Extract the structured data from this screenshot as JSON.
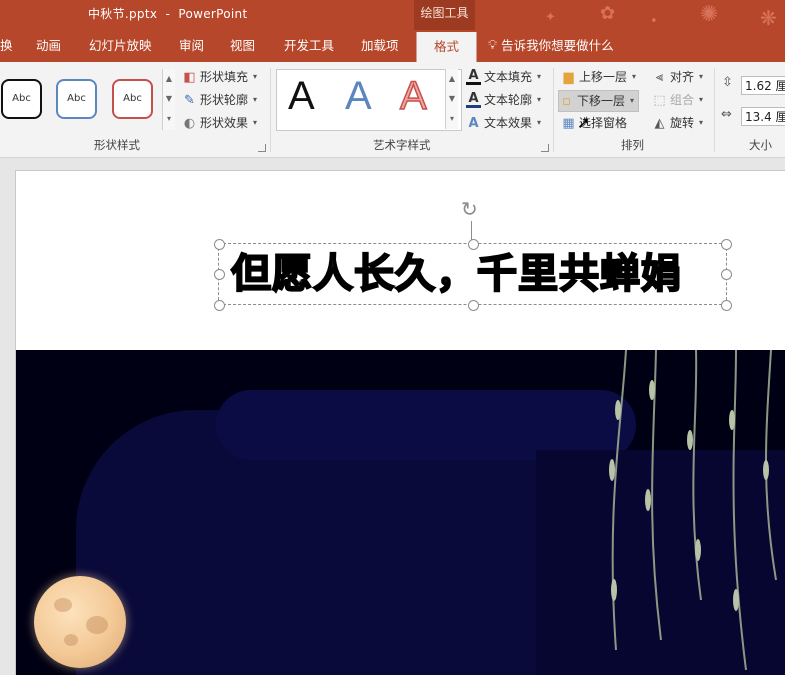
{
  "titlebar": {
    "filename": "中秋节.pptx",
    "separator": "-",
    "app": "PowerPoint",
    "context_tab_group": "绘图工具"
  },
  "tabs": [
    {
      "label": "换"
    },
    {
      "label": "动画"
    },
    {
      "label": "幻灯片放映"
    },
    {
      "label": "审阅"
    },
    {
      "label": "视图"
    },
    {
      "label": "开发工具"
    },
    {
      "label": "加载项"
    },
    {
      "label": "格式",
      "active": true
    }
  ],
  "tell_me": "告诉我你想要做什么",
  "shape_styles": {
    "samples": [
      "Abc",
      "Abc",
      "Abc"
    ],
    "fill": "形状填充",
    "outline": "形状轮廓",
    "effects": "形状效果",
    "group_label": "形状样式"
  },
  "wordart": {
    "letters": [
      "A",
      "A",
      "A"
    ],
    "text_fill": "文本填充",
    "text_outline": "文本轮廓",
    "text_effects": "文本效果",
    "group_label": "艺术字样式"
  },
  "arrange": {
    "bring_forward": "上移一层",
    "send_backward": "下移一层",
    "selection_pane": "选择窗格",
    "align": "对齐",
    "group": "组合",
    "rotate": "旋转",
    "group_label": "排列"
  },
  "size": {
    "height": "1.62 厘",
    "width": "13.4 厘",
    "group_label": "大小"
  },
  "slide": {
    "title_text": "但愿人长久，千里共蝉娟"
  },
  "colors": {
    "accent": "#b7472a",
    "ribbon_bg": "#f3f3f3",
    "night": "#000014"
  }
}
